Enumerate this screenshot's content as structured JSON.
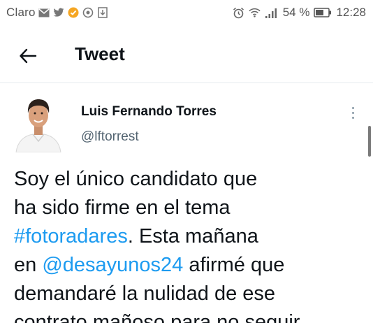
{
  "status_bar": {
    "carrier": "Claro",
    "battery": "54 %",
    "time": "12:28",
    "icons_left": [
      "mail-icon",
      "twitter-icon",
      "app-icon",
      "camera-icon",
      "download-icon"
    ],
    "icons_right": [
      "alarm-icon",
      "wifi-icon",
      "signal-icon",
      "battery-icon"
    ]
  },
  "header": {
    "title": "Tweet",
    "back_icon": "back-arrow-icon"
  },
  "tweet": {
    "author": {
      "name": "Luis Fernando Torres",
      "handle": "@lftorrest"
    },
    "lines": [
      [
        {
          "t": "Soy el único candidato que",
          "link": false
        }
      ],
      [
        {
          "t": "ha sido firme en el tema",
          "link": false
        }
      ],
      [
        {
          "t": "#fotoradares",
          "link": true
        },
        {
          "t": ". Esta mañana",
          "link": false
        }
      ],
      [
        {
          "t": "en ",
          "link": false
        },
        {
          "t": "@desayunos24",
          "link": true
        },
        {
          "t": " afirmé que",
          "link": false
        }
      ],
      [
        {
          "t": "demandaré la nulidad de ese",
          "link": false
        }
      ],
      [
        {
          "t": "contrato mañoso para no seguir",
          "link": false
        }
      ]
    ]
  },
  "colors": {
    "link": "#1d9bf0",
    "text": "#0f1419",
    "secondary": "#536471"
  }
}
